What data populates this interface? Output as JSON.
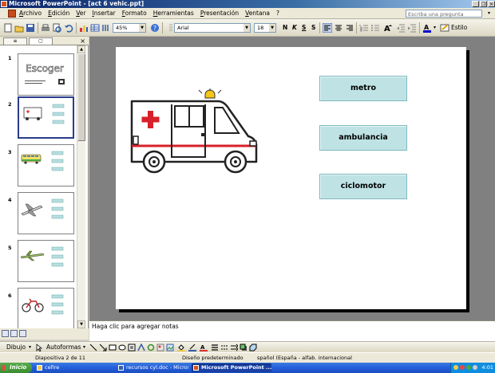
{
  "window": {
    "title": "Microsoft PowerPoint - [act 6 vehic.ppt]",
    "controls": [
      "_",
      "أ",
      "×"
    ]
  },
  "menubar": {
    "items": [
      "Archivo",
      "Edición",
      "Ver",
      "Insertar",
      "Formato",
      "Herramientas",
      "Presentación",
      "Ventana",
      "?"
    ],
    "ask_placeholder": "Escriba una pregunta"
  },
  "toolbar": {
    "zoom": "45%",
    "font": "Arial",
    "size": "18",
    "bold": "N",
    "italic": "K",
    "underline": "S",
    "shadow": "S",
    "design": "Estilo"
  },
  "panel": {
    "tabs": [
      "≡",
      "▢"
    ],
    "close": "×",
    "slides": [
      {
        "number": "1",
        "title": "Escoger"
      },
      {
        "number": "2"
      },
      {
        "number": "3"
      },
      {
        "number": "4"
      },
      {
        "number": "5"
      },
      {
        "number": "6"
      }
    ],
    "selected_slide": 2
  },
  "slide": {
    "answers": [
      "metro",
      "ambulancia",
      "ciclomotor"
    ]
  },
  "notes": {
    "placeholder": "Haga clic para agregar notas"
  },
  "drawbar": {
    "dibujo": "Dibujo",
    "autoformas": "Autoformas"
  },
  "status": {
    "slide": "Diapositiva 2 de 11",
    "design": "Diseño predeterminado",
    "language": "spañol (España - alfab. internacional"
  },
  "taskbar": {
    "start": "Inicio",
    "tasks": [
      "cefire",
      "recursos cyl.doc - Micros...",
      "Microsoft PowerPoint ..."
    ],
    "clock": "4:01"
  },
  "colors": {
    "answer_fill": "#bfe3e5",
    "title_bar": "#0a246a",
    "taskbar": "#245edb",
    "ambulance_red": "#d8202a"
  }
}
